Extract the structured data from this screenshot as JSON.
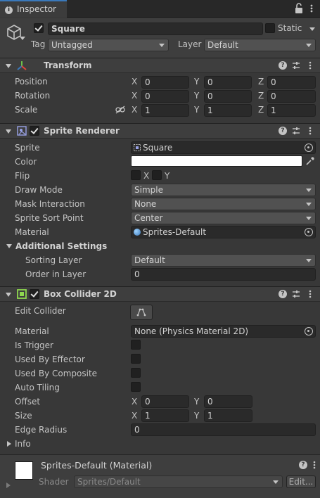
{
  "tab": {
    "title": "Inspector"
  },
  "object": {
    "name": "Square",
    "static_label": "Static",
    "tag_label": "Tag",
    "tag_value": "Untagged",
    "layer_label": "Layer",
    "layer_value": "Default"
  },
  "transform": {
    "title": "Transform",
    "rows": [
      {
        "label": "Position",
        "x": "0",
        "y": "0",
        "z": "0"
      },
      {
        "label": "Rotation",
        "x": "0",
        "y": "0",
        "z": "0"
      },
      {
        "label": "Scale",
        "x": "1",
        "y": "1",
        "z": "1"
      }
    ]
  },
  "axes": {
    "x": "X",
    "y": "Y",
    "z": "Z"
  },
  "sprite_renderer": {
    "title": "Sprite Renderer",
    "sprite_label": "Sprite",
    "sprite_value": "Square",
    "color_label": "Color",
    "flip_label": "Flip",
    "draw_mode_label": "Draw Mode",
    "draw_mode_value": "Simple",
    "mask_label": "Mask Interaction",
    "mask_value": "None",
    "sort_point_label": "Sprite Sort Point",
    "sort_point_value": "Center",
    "material_label": "Material",
    "material_value": "Sprites-Default",
    "additional_label": "Additional Settings",
    "sorting_layer_label": "Sorting Layer",
    "sorting_layer_value": "Default",
    "order_label": "Order in Layer",
    "order_value": "0"
  },
  "box_collider": {
    "title": "Box Collider 2D",
    "edit_label": "Edit Collider",
    "material_label": "Material",
    "material_value": "None (Physics Material 2D)",
    "is_trigger_label": "Is Trigger",
    "effector_label": "Used By Effector",
    "composite_label": "Used By Composite",
    "auto_tiling_label": "Auto Tiling",
    "offset_label": "Offset",
    "offset_x": "0",
    "offset_y": "0",
    "size_label": "Size",
    "size_x": "1",
    "size_y": "1",
    "edge_label": "Edge Radius",
    "edge_value": "0",
    "info_label": "Info"
  },
  "material_footer": {
    "title": "Sprites-Default (Material)",
    "shader_label": "Shader",
    "shader_value": "Sprites/Default",
    "edit_label": "Edit..."
  },
  "colors": {
    "accent": "#3a79bb",
    "panel": "#383838",
    "header": "#3e3e3e"
  }
}
